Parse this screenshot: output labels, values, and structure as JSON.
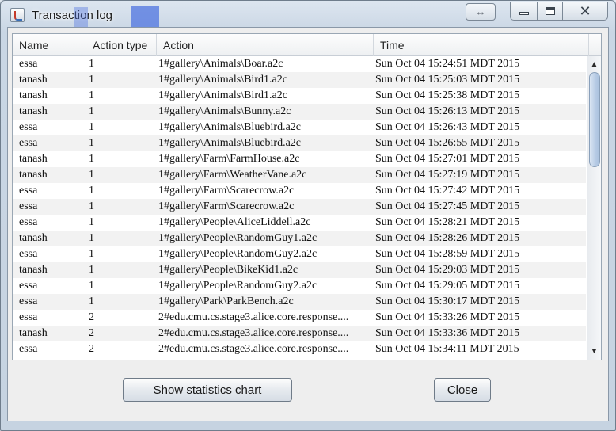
{
  "window": {
    "title": "Transaction log",
    "resize_glyph": "⇔",
    "close_glyph": "✕"
  },
  "table": {
    "columns": [
      "Name",
      "Action type",
      "Action",
      "Time"
    ],
    "rows": [
      [
        "essa",
        "1",
        "1#gallery\\Animals\\Boar.a2c",
        "Sun Oct 04 15:24:51 MDT 2015"
      ],
      [
        "tanash",
        "1",
        "1#gallery\\Animals\\Bird1.a2c",
        "Sun Oct 04 15:25:03 MDT 2015"
      ],
      [
        "tanash",
        "1",
        "1#gallery\\Animals\\Bird1.a2c",
        "Sun Oct 04 15:25:38 MDT 2015"
      ],
      [
        "tanash",
        "1",
        "1#gallery\\Animals\\Bunny.a2c",
        "Sun Oct 04 15:26:13 MDT 2015"
      ],
      [
        "essa",
        "1",
        "1#gallery\\Animals\\Bluebird.a2c",
        "Sun Oct 04 15:26:43 MDT 2015"
      ],
      [
        "essa",
        "1",
        "1#gallery\\Animals\\Bluebird.a2c",
        "Sun Oct 04 15:26:55 MDT 2015"
      ],
      [
        "tanash",
        "1",
        "1#gallery\\Farm\\FarmHouse.a2c",
        "Sun Oct 04 15:27:01 MDT 2015"
      ],
      [
        "tanash",
        "1",
        "1#gallery\\Farm\\WeatherVane.a2c",
        "Sun Oct 04 15:27:19 MDT 2015"
      ],
      [
        "essa",
        "1",
        "1#gallery\\Farm\\Scarecrow.a2c",
        "Sun Oct 04 15:27:42 MDT 2015"
      ],
      [
        "essa",
        "1",
        "1#gallery\\Farm\\Scarecrow.a2c",
        "Sun Oct 04 15:27:45 MDT 2015"
      ],
      [
        "essa",
        "1",
        "1#gallery\\People\\AliceLiddell.a2c",
        "Sun Oct 04 15:28:21 MDT 2015"
      ],
      [
        "tanash",
        "1",
        "1#gallery\\People\\RandomGuy1.a2c",
        "Sun Oct 04 15:28:26 MDT 2015"
      ],
      [
        "essa",
        "1",
        "1#gallery\\People\\RandomGuy2.a2c",
        "Sun Oct 04 15:28:59 MDT 2015"
      ],
      [
        "tanash",
        "1",
        "1#gallery\\People\\BikeKid1.a2c",
        "Sun Oct 04 15:29:03 MDT 2015"
      ],
      [
        "essa",
        "1",
        "1#gallery\\People\\RandomGuy2.a2c",
        "Sun Oct 04 15:29:05 MDT 2015"
      ],
      [
        "essa",
        "1",
        "1#gallery\\Park\\ParkBench.a2c",
        "Sun Oct 04 15:30:17 MDT 2015"
      ],
      [
        "essa",
        "2",
        "2#edu.cmu.cs.stage3.alice.core.response....",
        "Sun Oct 04 15:33:26 MDT 2015"
      ],
      [
        "tanash",
        "2",
        "2#edu.cmu.cs.stage3.alice.core.response....",
        "Sun Oct 04 15:33:36 MDT 2015"
      ],
      [
        "essa",
        "2",
        "2#edu.cmu.cs.stage3.alice.core.response....",
        "Sun Oct 04 15:34:11 MDT 2015"
      ]
    ]
  },
  "scrollbar": {
    "up_glyph": "▲",
    "down_glyph": "▼",
    "thumb_start": 0.0,
    "thumb_fraction": 0.35
  },
  "buttons": {
    "stats_label": "Show statistics chart",
    "close_label": "Close"
  }
}
